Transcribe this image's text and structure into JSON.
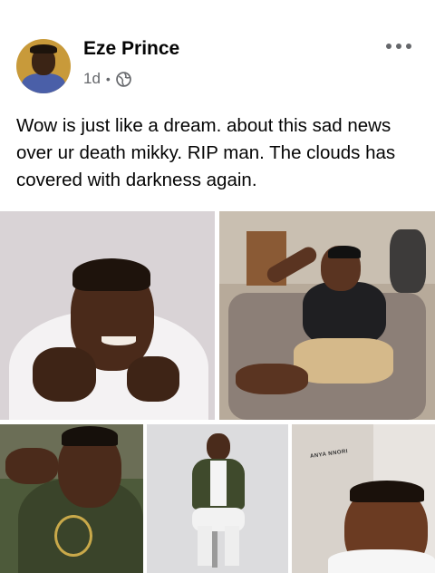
{
  "post": {
    "author_name": "Eze Prince",
    "time_ago": "1d",
    "separator": "•",
    "privacy_icon": "globe-icon",
    "more_icon": "more-options-icon",
    "text": "Wow is just like a dream. about this sad news over ur death mikky. RIP man. The clouds has covered with darkness again."
  },
  "photos": {
    "photo_5_caption": "ANYA NNORI"
  }
}
